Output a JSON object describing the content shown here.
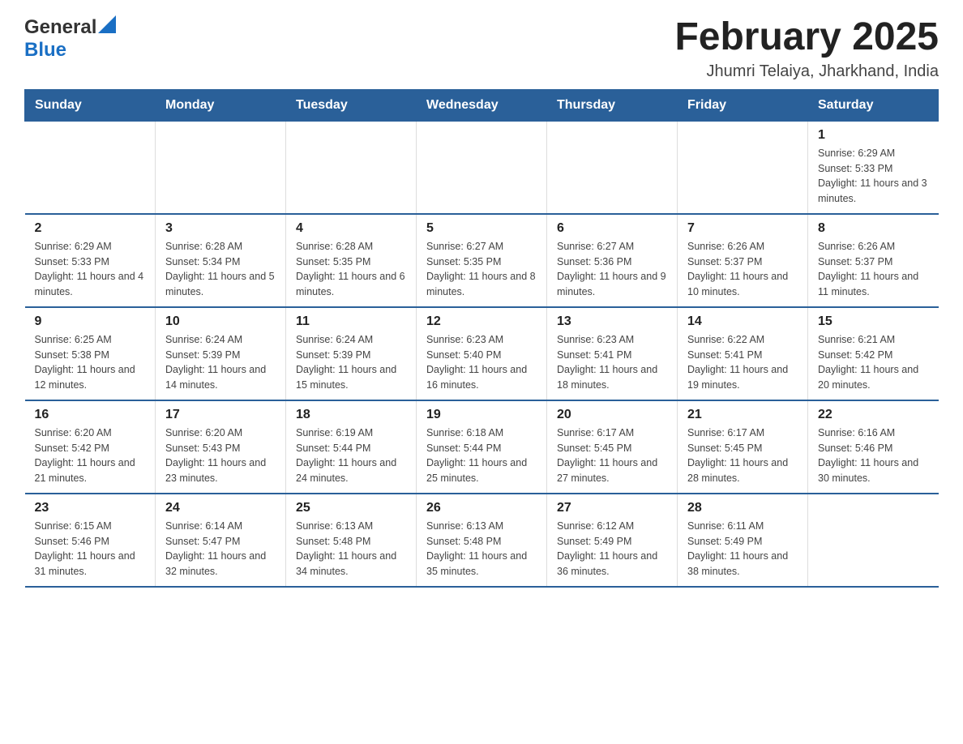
{
  "logo": {
    "text_general": "General",
    "text_blue": "Blue"
  },
  "title": "February 2025",
  "subtitle": "Jhumri Telaiya, Jharkhand, India",
  "days_of_week": [
    "Sunday",
    "Monday",
    "Tuesday",
    "Wednesday",
    "Thursday",
    "Friday",
    "Saturday"
  ],
  "weeks": [
    [
      {
        "day": "",
        "info": ""
      },
      {
        "day": "",
        "info": ""
      },
      {
        "day": "",
        "info": ""
      },
      {
        "day": "",
        "info": ""
      },
      {
        "day": "",
        "info": ""
      },
      {
        "day": "",
        "info": ""
      },
      {
        "day": "1",
        "info": "Sunrise: 6:29 AM\nSunset: 5:33 PM\nDaylight: 11 hours and 3 minutes."
      }
    ],
    [
      {
        "day": "2",
        "info": "Sunrise: 6:29 AM\nSunset: 5:33 PM\nDaylight: 11 hours and 4 minutes."
      },
      {
        "day": "3",
        "info": "Sunrise: 6:28 AM\nSunset: 5:34 PM\nDaylight: 11 hours and 5 minutes."
      },
      {
        "day": "4",
        "info": "Sunrise: 6:28 AM\nSunset: 5:35 PM\nDaylight: 11 hours and 6 minutes."
      },
      {
        "day": "5",
        "info": "Sunrise: 6:27 AM\nSunset: 5:35 PM\nDaylight: 11 hours and 8 minutes."
      },
      {
        "day": "6",
        "info": "Sunrise: 6:27 AM\nSunset: 5:36 PM\nDaylight: 11 hours and 9 minutes."
      },
      {
        "day": "7",
        "info": "Sunrise: 6:26 AM\nSunset: 5:37 PM\nDaylight: 11 hours and 10 minutes."
      },
      {
        "day": "8",
        "info": "Sunrise: 6:26 AM\nSunset: 5:37 PM\nDaylight: 11 hours and 11 minutes."
      }
    ],
    [
      {
        "day": "9",
        "info": "Sunrise: 6:25 AM\nSunset: 5:38 PM\nDaylight: 11 hours and 12 minutes."
      },
      {
        "day": "10",
        "info": "Sunrise: 6:24 AM\nSunset: 5:39 PM\nDaylight: 11 hours and 14 minutes."
      },
      {
        "day": "11",
        "info": "Sunrise: 6:24 AM\nSunset: 5:39 PM\nDaylight: 11 hours and 15 minutes."
      },
      {
        "day": "12",
        "info": "Sunrise: 6:23 AM\nSunset: 5:40 PM\nDaylight: 11 hours and 16 minutes."
      },
      {
        "day": "13",
        "info": "Sunrise: 6:23 AM\nSunset: 5:41 PM\nDaylight: 11 hours and 18 minutes."
      },
      {
        "day": "14",
        "info": "Sunrise: 6:22 AM\nSunset: 5:41 PM\nDaylight: 11 hours and 19 minutes."
      },
      {
        "day": "15",
        "info": "Sunrise: 6:21 AM\nSunset: 5:42 PM\nDaylight: 11 hours and 20 minutes."
      }
    ],
    [
      {
        "day": "16",
        "info": "Sunrise: 6:20 AM\nSunset: 5:42 PM\nDaylight: 11 hours and 21 minutes."
      },
      {
        "day": "17",
        "info": "Sunrise: 6:20 AM\nSunset: 5:43 PM\nDaylight: 11 hours and 23 minutes."
      },
      {
        "day": "18",
        "info": "Sunrise: 6:19 AM\nSunset: 5:44 PM\nDaylight: 11 hours and 24 minutes."
      },
      {
        "day": "19",
        "info": "Sunrise: 6:18 AM\nSunset: 5:44 PM\nDaylight: 11 hours and 25 minutes."
      },
      {
        "day": "20",
        "info": "Sunrise: 6:17 AM\nSunset: 5:45 PM\nDaylight: 11 hours and 27 minutes."
      },
      {
        "day": "21",
        "info": "Sunrise: 6:17 AM\nSunset: 5:45 PM\nDaylight: 11 hours and 28 minutes."
      },
      {
        "day": "22",
        "info": "Sunrise: 6:16 AM\nSunset: 5:46 PM\nDaylight: 11 hours and 30 minutes."
      }
    ],
    [
      {
        "day": "23",
        "info": "Sunrise: 6:15 AM\nSunset: 5:46 PM\nDaylight: 11 hours and 31 minutes."
      },
      {
        "day": "24",
        "info": "Sunrise: 6:14 AM\nSunset: 5:47 PM\nDaylight: 11 hours and 32 minutes."
      },
      {
        "day": "25",
        "info": "Sunrise: 6:13 AM\nSunset: 5:48 PM\nDaylight: 11 hours and 34 minutes."
      },
      {
        "day": "26",
        "info": "Sunrise: 6:13 AM\nSunset: 5:48 PM\nDaylight: 11 hours and 35 minutes."
      },
      {
        "day": "27",
        "info": "Sunrise: 6:12 AM\nSunset: 5:49 PM\nDaylight: 11 hours and 36 minutes."
      },
      {
        "day": "28",
        "info": "Sunrise: 6:11 AM\nSunset: 5:49 PM\nDaylight: 11 hours and 38 minutes."
      },
      {
        "day": "",
        "info": ""
      }
    ]
  ]
}
